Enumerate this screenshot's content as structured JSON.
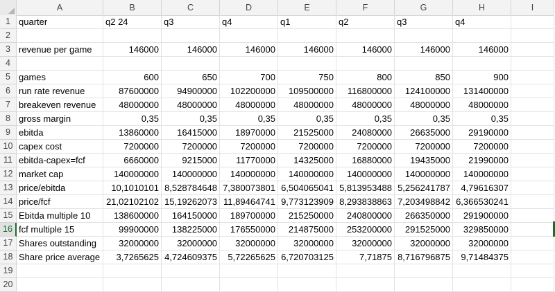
{
  "columns": [
    "A",
    "B",
    "C",
    "D",
    "E",
    "F",
    "G",
    "H",
    "I"
  ],
  "rows": [
    {
      "n": "1",
      "a": "quarter",
      "v": [
        "q2 24",
        "q3",
        "q4",
        "q1",
        "q2",
        "q3",
        "q4"
      ],
      "text": true
    },
    {
      "n": "2",
      "a": "",
      "v": [
        "",
        "",
        "",
        "",
        "",
        "",
        ""
      ]
    },
    {
      "n": "3",
      "a": "revenue per game",
      "v": [
        "146000",
        "146000",
        "146000",
        "146000",
        "146000",
        "146000",
        "146000"
      ]
    },
    {
      "n": "4",
      "a": "",
      "v": [
        "",
        "",
        "",
        "",
        "",
        "",
        ""
      ]
    },
    {
      "n": "5",
      "a": "games",
      "v": [
        "600",
        "650",
        "700",
        "750",
        "800",
        "850",
        "900"
      ]
    },
    {
      "n": "6",
      "a": "run rate revenue",
      "v": [
        "87600000",
        "94900000",
        "102200000",
        "109500000",
        "116800000",
        "124100000",
        "131400000"
      ]
    },
    {
      "n": "7",
      "a": "breakeven revenue",
      "v": [
        "48000000",
        "48000000",
        "48000000",
        "48000000",
        "48000000",
        "48000000",
        "48000000"
      ]
    },
    {
      "n": "8",
      "a": "gross margin",
      "v": [
        "0,35",
        "0,35",
        "0,35",
        "0,35",
        "0,35",
        "0,35",
        "0,35"
      ]
    },
    {
      "n": "9",
      "a": "ebitda",
      "v": [
        "13860000",
        "16415000",
        "18970000",
        "21525000",
        "24080000",
        "26635000",
        "29190000"
      ]
    },
    {
      "n": "10",
      "a": "capex cost",
      "v": [
        "7200000",
        "7200000",
        "7200000",
        "7200000",
        "7200000",
        "7200000",
        "7200000"
      ]
    },
    {
      "n": "11",
      "a": "ebitda-capex=fcf",
      "v": [
        "6660000",
        "9215000",
        "11770000",
        "14325000",
        "16880000",
        "19435000",
        "21990000"
      ]
    },
    {
      "n": "12",
      "a": "market cap",
      "v": [
        "140000000",
        "140000000",
        "140000000",
        "140000000",
        "140000000",
        "140000000",
        "140000000"
      ]
    },
    {
      "n": "13",
      "a": "price/ebitda",
      "v": [
        "10,1010101",
        "8,528784648",
        "7,380073801",
        "6,504065041",
        "5,813953488",
        "5,256241787",
        "4,79616307"
      ]
    },
    {
      "n": "14",
      "a": "price/fcf",
      "v": [
        "21,02102102",
        "15,19262073",
        "11,89464741",
        "9,773123909",
        "8,293838863",
        "7,203498842",
        "6,366530241"
      ]
    },
    {
      "n": "15",
      "a": "Ebitda multiple 10",
      "v": [
        "138600000",
        "164150000",
        "189700000",
        "215250000",
        "240800000",
        "266350000",
        "291900000"
      ]
    },
    {
      "n": "16",
      "a": "fcf multiple 15",
      "v": [
        "99900000",
        "138225000",
        "176550000",
        "214875000",
        "253200000",
        "291525000",
        "329850000"
      ]
    },
    {
      "n": "17",
      "a": "Shares outstanding",
      "v": [
        "32000000",
        "32000000",
        "32000000",
        "32000000",
        "32000000",
        "32000000",
        "32000000"
      ]
    },
    {
      "n": "18",
      "a": "Share price average",
      "v": [
        "3,7265625",
        "4,724609375",
        "5,72265625",
        "6,720703125",
        "7,71875",
        "8,716796875",
        "9,71484375"
      ]
    },
    {
      "n": "19",
      "a": "",
      "v": [
        "",
        "",
        "",
        "",
        "",
        "",
        ""
      ]
    },
    {
      "n": "20",
      "a": "",
      "v": [
        "",
        "",
        "",
        "",
        "",
        "",
        ""
      ]
    }
  ],
  "selected_row": "16"
}
